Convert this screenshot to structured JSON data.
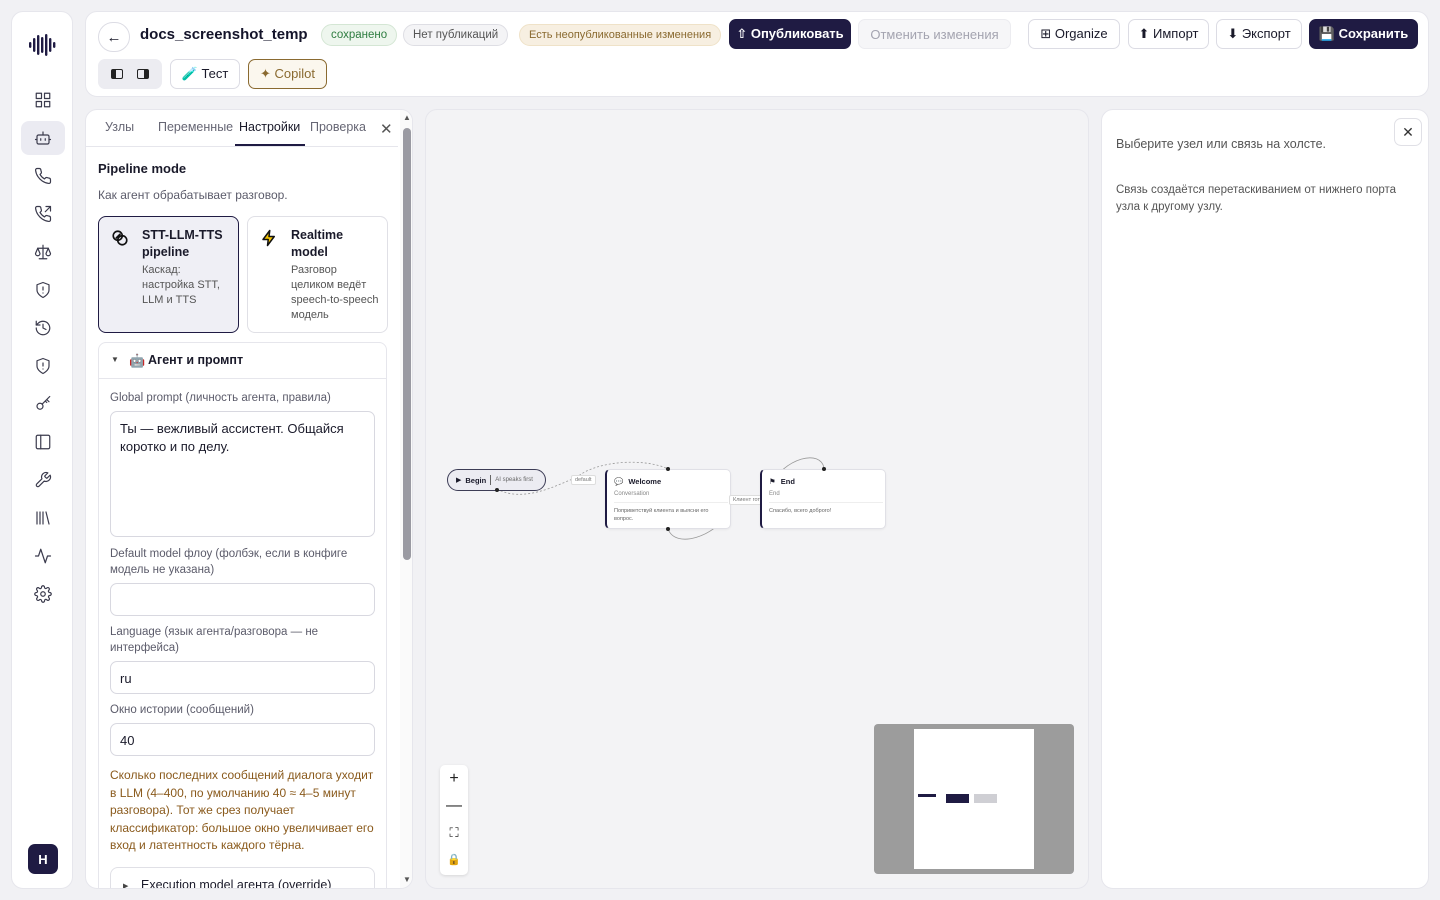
{
  "topbar": {
    "back_glyph": "←",
    "title": "docs_screenshot_temp",
    "status_saved": "сохранено",
    "status_publications": "Нет публикаций",
    "status_unpublished": "Есть неопубликованные изменения",
    "publish_label": "⇧ Опубликовать",
    "revert_label": "Отменить изменения",
    "organize_label": "⊞ Organize",
    "import_label": "⬆ Импорт",
    "export_label": "⬇ Экспорт",
    "save_label": "💾 Сохранить",
    "test_label": "🧪 Тест",
    "copilot_label": "✦ Copilot"
  },
  "sidebar": {
    "icons": [
      "dashboard-icon",
      "bot-icon",
      "phone-icon",
      "phone-outgoing-icon",
      "scale-icon",
      "shield-alert-icon",
      "history-icon",
      "shield-icon",
      "key-icon",
      "panel-icon",
      "tool-icon",
      "library-icon",
      "activity-icon",
      "settings-icon"
    ],
    "active_index": 1,
    "avatar_letter": "H"
  },
  "left_panel": {
    "tabs": [
      "Узлы",
      "Переменные",
      "Настройки",
      "Проверка"
    ],
    "active_tab": "Настройки",
    "pipeline_title": "Pipeline mode",
    "pipeline_subtitle": "Как агент обрабатывает разговор.",
    "modes": [
      {
        "title": "STT-LLM-TTS pipeline",
        "desc": "Каскад: настройка STT, LLM и TTS",
        "selected": true
      },
      {
        "title": "Realtime model",
        "desc": "Разговор целиком ведёт speech-to-speech модель",
        "selected": false
      }
    ],
    "agent_section_emoji": "🤖",
    "agent_section_title": "Агент и промпт",
    "global_prompt_label": "Global prompt (личность агента, правила)",
    "global_prompt_value": "Ты — вежливый ассистент. Общайся коротко и по делу.",
    "default_model_label": "Default model флоу (фолбэк, если в конфиге модель не указана)",
    "default_model_value": "",
    "language_label": "Language (язык агента/разговора — не интерфейса)",
    "language_value": "ru",
    "history_label": "Окно истории (сообщений)",
    "history_value": "40",
    "history_note": "Сколько последних сообщений диалога уходит в LLM (4–400, по умолчанию 40 ≈ 4–5 минут разговора). Тот же срез получает классификатор: большое окно увеличивает его вход и латентность каждого тёрна.",
    "execution_model_label": "Execution model агента (override)"
  },
  "canvas": {
    "begin_label": "Begin",
    "begin_sub": "AI speaks first",
    "edge_default": "default",
    "edge_client": "Клиент гот",
    "nodes": [
      {
        "id": "welcome",
        "title": "Welcome",
        "type": "Conversation",
        "desc": "Поприветствуй клиента и выясни его вопрос."
      },
      {
        "id": "end",
        "title": "End",
        "type": "End",
        "desc": "Спасибо, всего доброго!"
      }
    ],
    "controls": [
      "+",
      "—",
      "⛶",
      "🔒"
    ]
  },
  "right_panel": {
    "hint": "Выберите узел или связь на холсте.",
    "help": "Связь создаётся перетаскиванием от нижнего порта узла к другому узлу."
  },
  "colors": {
    "accent": "#1f1b43",
    "warning_text": "#8a5a1c",
    "saved_green": "#2e7d40"
  }
}
